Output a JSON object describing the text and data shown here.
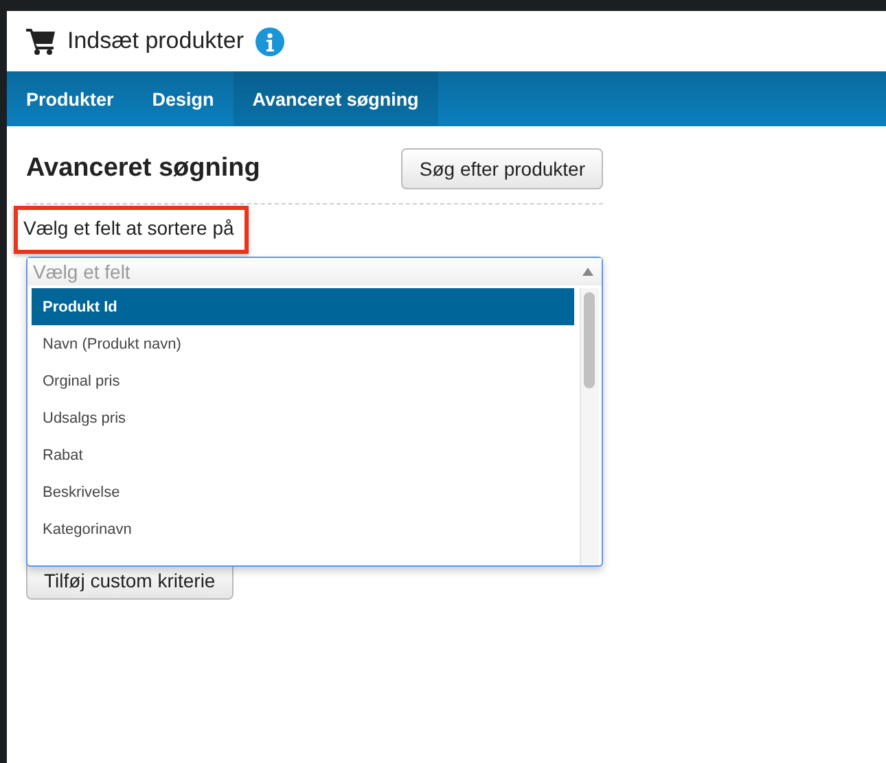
{
  "header": {
    "title": "Indsæt produkter"
  },
  "tabs": [
    {
      "label": "Produkter",
      "selected": false
    },
    {
      "label": "Design",
      "selected": false
    },
    {
      "label": "Avanceret søgning",
      "selected": true
    }
  ],
  "section": {
    "heading": "Avanceret søgning",
    "search_button": "Søg efter produkter"
  },
  "sort_field": {
    "label": "Vælg et felt at sortere på",
    "highlighted": true,
    "placeholder": "Vælg et felt",
    "options": [
      {
        "label": "Produkt Id",
        "selected": true
      },
      {
        "label": "Navn (Produkt navn)",
        "selected": false
      },
      {
        "label": "Orginal pris",
        "selected": false
      },
      {
        "label": "Udsalgs pris",
        "selected": false
      },
      {
        "label": "Rabat",
        "selected": false
      },
      {
        "label": "Beskrivelse",
        "selected": false
      },
      {
        "label": "Kategorinavn",
        "selected": false
      }
    ]
  },
  "add_button": "Tilføj custom kriterie"
}
